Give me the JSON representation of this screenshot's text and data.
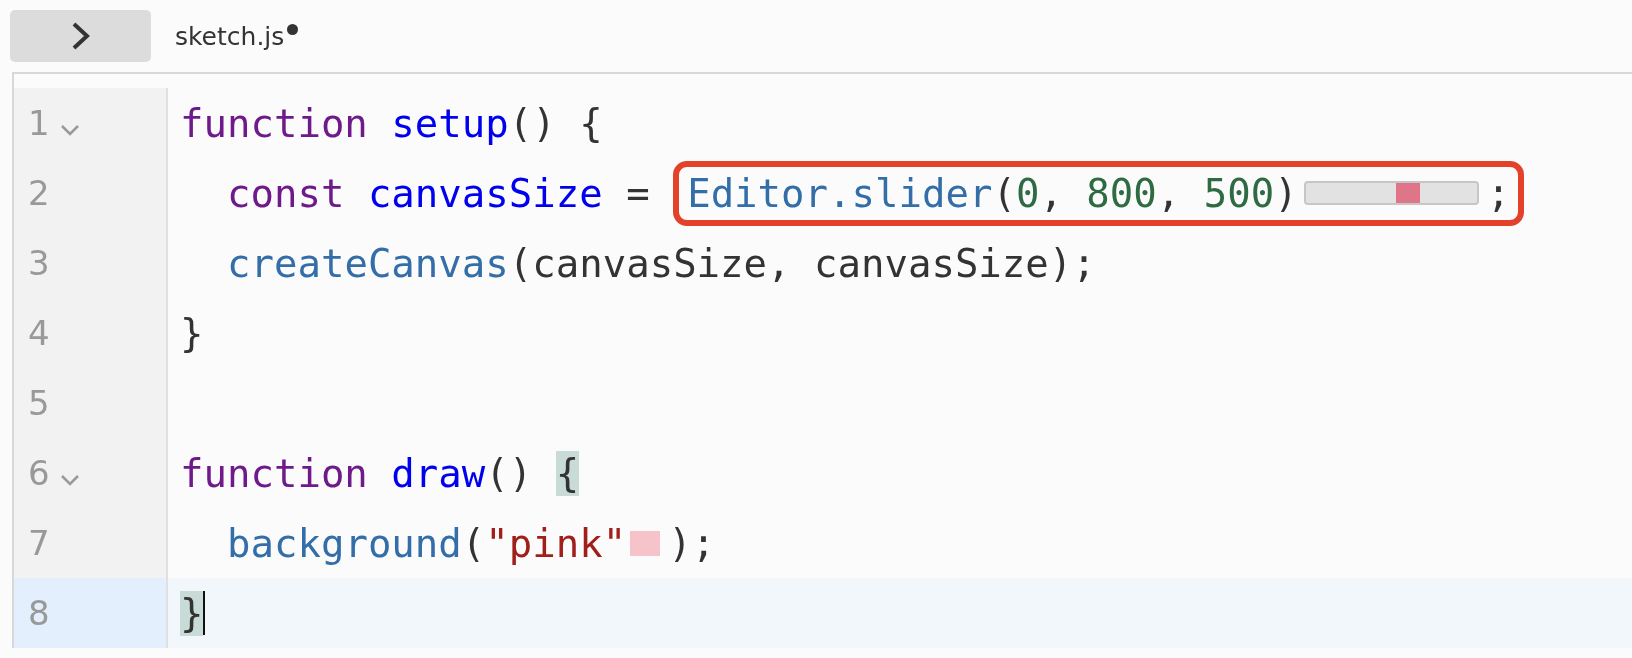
{
  "tab": {
    "filename": "sketch.js",
    "unsaved": true
  },
  "lines": [
    {
      "number": "1",
      "foldable": true,
      "selected": false,
      "cursor": false,
      "indented": false,
      "tokens": [
        {
          "kind": "keyword",
          "text": "function "
        },
        {
          "kind": "def",
          "text": "setup"
        },
        {
          "kind": "plain",
          "text": "() {"
        }
      ]
    },
    {
      "number": "2",
      "foldable": false,
      "selected": false,
      "cursor": false,
      "indented": true,
      "tokens": [
        {
          "kind": "keyword",
          "text": "const "
        },
        {
          "kind": "def",
          "text": "canvasSize"
        },
        {
          "kind": "plain",
          "text": " = "
        },
        {
          "kind": "group",
          "highlighted": true,
          "children": [
            {
              "kind": "call",
              "text": "Editor.slider"
            },
            {
              "kind": "plain",
              "text": "("
            },
            {
              "kind": "number",
              "text": "0"
            },
            {
              "kind": "plain",
              "text": ", "
            },
            {
              "kind": "number",
              "text": "800"
            },
            {
              "kind": "plain",
              "text": ", "
            },
            {
              "kind": "number",
              "text": "500"
            },
            {
              "kind": "plain",
              "text": ")"
            },
            {
              "kind": "slider",
              "level": 0.6
            },
            {
              "kind": "plain",
              "text": ";"
            }
          ]
        }
      ]
    },
    {
      "number": "3",
      "foldable": false,
      "selected": false,
      "cursor": false,
      "indented": true,
      "tokens": [
        {
          "kind": "call",
          "text": "createCanvas"
        },
        {
          "kind": "plain",
          "text": "(canvasSize, canvasSize);"
        }
      ]
    },
    {
      "number": "4",
      "foldable": false,
      "selected": false,
      "cursor": false,
      "indented": false,
      "tokens": [
        {
          "kind": "plain",
          "text": "}"
        }
      ]
    },
    {
      "number": "5",
      "foldable": false,
      "selected": false,
      "cursor": false
    },
    {
      "number": "6",
      "foldable": true,
      "selected": false,
      "cursor": false,
      "indented": false,
      "tokens": [
        {
          "kind": "keyword",
          "text": "function "
        },
        {
          "kind": "def",
          "text": "draw"
        },
        {
          "kind": "plain",
          "text": "() "
        },
        {
          "kind": "bracket",
          "text": "{",
          "matched": true
        }
      ]
    },
    {
      "number": "7",
      "foldable": false,
      "selected": false,
      "cursor": false,
      "indented": true,
      "tokens": [
        {
          "kind": "call",
          "text": "background"
        },
        {
          "kind": "plain",
          "text": "("
        },
        {
          "kind": "string",
          "text": "\"pink\""
        },
        {
          "kind": "swatch",
          "color": "#f5c3c9"
        },
        {
          "kind": "plain",
          "text": ");"
        }
      ]
    },
    {
      "number": "8",
      "foldable": false,
      "selected": true,
      "cursor": true,
      "indented": false,
      "tokens": [
        {
          "kind": "bracket",
          "text": "}",
          "matched": true
        }
      ]
    }
  ]
}
